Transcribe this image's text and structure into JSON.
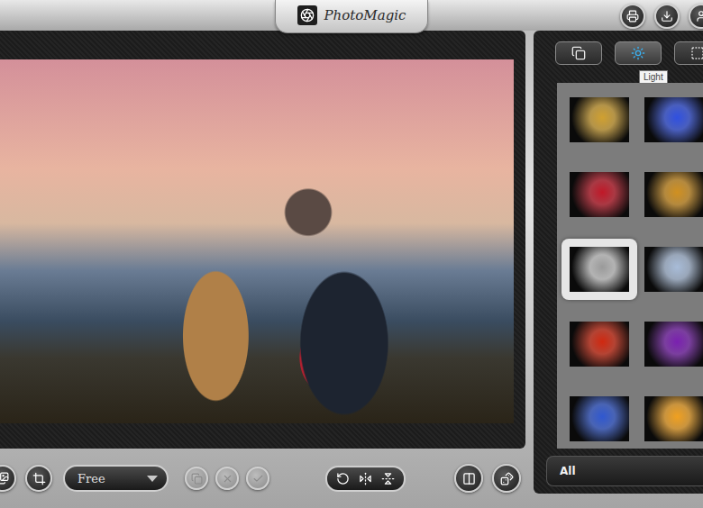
{
  "window": {
    "title": "PhotoMagic"
  },
  "tabs": [
    {
      "kind": "layers",
      "selected": false
    },
    {
      "kind": "light",
      "selected": true
    },
    {
      "kind": "frame",
      "selected": false
    }
  ],
  "tooltip": {
    "text": "Light"
  },
  "thumbnails": [
    {
      "selected": false,
      "color": "#d0a030"
    },
    {
      "selected": false,
      "color": "#3050e0"
    },
    {
      "selected": false,
      "color": "#c01828"
    },
    {
      "selected": false,
      "color": "#d09020"
    },
    {
      "selected": true,
      "color": "#9a9a9a"
    },
    {
      "selected": false,
      "color": "#a8bcd8"
    },
    {
      "selected": false,
      "color": "#d02810"
    },
    {
      "selected": false,
      "color": "#7a20b0"
    },
    {
      "selected": false,
      "color": "#3058d0"
    },
    {
      "selected": false,
      "color": "#f0a020"
    }
  ],
  "filter": {
    "value": "All"
  },
  "toolbar": {
    "ratio": {
      "value": "Free"
    },
    "edit_actions": [
      {
        "kind": "duplicate",
        "disabled": true
      },
      {
        "kind": "cancel",
        "disabled": true
      },
      {
        "kind": "apply",
        "disabled": true
      }
    ]
  }
}
